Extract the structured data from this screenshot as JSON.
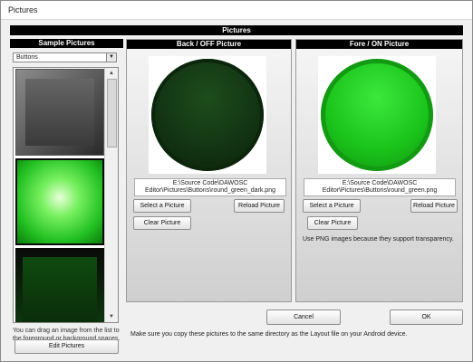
{
  "window": {
    "title": "Pictures"
  },
  "banner": "Pictures",
  "sample": {
    "header": "Sample Pictures",
    "dropdown_value": "Buttons",
    "hint": "You can drag an image from the list to the foreground or background spaces.",
    "edit_button": "Edit Pictures"
  },
  "back": {
    "header": "Back / OFF Picture",
    "path_line1": "E:\\Source Code\\DAWOSC",
    "path_line2": "Editor\\Pictures\\Buttons\\round_green_dark.png",
    "select_button": "Select a Picture",
    "reload_button": "Reload Picture",
    "clear_button": "Clear Picture"
  },
  "fore": {
    "header": "Fore / ON Picture",
    "path_line1": "E:\\Source Code\\DAWOSC",
    "path_line2": "Editor\\Pictures\\Buttons\\round_green.png",
    "select_button": "Select a Picture",
    "reload_button": "Reload Picture",
    "clear_button": "Clear Picture",
    "note": "Use PNG images because they support transparency."
  },
  "footer": {
    "cancel_button": "Cancel",
    "ok_button": "OK",
    "note": "Make sure you copy these pictures to the same directory as the Layout file on your Android device."
  }
}
